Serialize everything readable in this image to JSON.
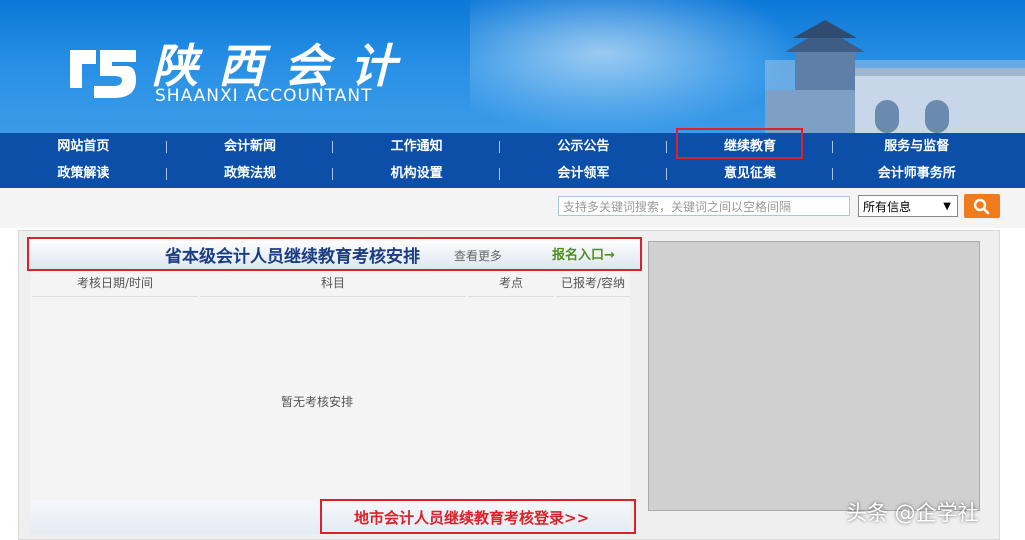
{
  "header": {
    "logo_cn": "陕西会计",
    "logo_en": "SHAANXI ACCOUNTANT"
  },
  "nav": {
    "row1": [
      "网站首页",
      "会计新闻",
      "工作通知",
      "公示公告",
      "继续教育",
      "服务与监督"
    ],
    "row2": [
      "政策解读",
      "政策法规",
      "机构设置",
      "会计领军",
      "意见征集",
      "会计师事务所"
    ]
  },
  "search": {
    "placeholder": "支持多关键词搜索，关键词之间以空格间隔",
    "scope_selected": "所有信息",
    "button_icon": "search-icon"
  },
  "exam_section": {
    "title": "省本级会计人员继续教育考核安排",
    "more": "查看更多",
    "signup": "报名入口→",
    "columns": [
      "考核日期/时间",
      "科目",
      "考点",
      "已报考/容纳"
    ],
    "empty_text": "暂无考核安排",
    "city_login": "地市会计人员继续教育考核登录>>"
  },
  "watermark": "头条 @企学社",
  "colors": {
    "nav_bg": "#0b4fa8",
    "highlight": "#d9222a",
    "title": "#1b3d82",
    "signup": "#4f8f1f",
    "search_button": "#f07b1a"
  }
}
